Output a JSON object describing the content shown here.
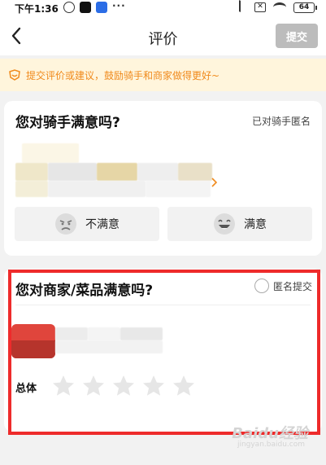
{
  "status_bar": {
    "time": "下午1:36",
    "left_icons": [
      "alarm-icon",
      "tiktok-icon",
      "baidu-icon",
      "more-dots-icon"
    ],
    "more_dots": "···",
    "right_icons": [
      "bluetooth-icon",
      "no-sim-icon",
      "wifi-icon",
      "battery-icon"
    ],
    "sim_mark": "✕",
    "battery": "64"
  },
  "nav": {
    "back_icon": "chevron-left-icon",
    "title": "评价",
    "submit_label": "提交"
  },
  "tip": {
    "icon": "reward-icon",
    "text": "提交评价或建议，鼓励骑手和商家做得更好~",
    "color": "#f08a1c"
  },
  "rider_card": {
    "title": "您对骑手满意吗?",
    "anonymous_label": "已对骑手匿名",
    "unsatisfied_label": "不满意",
    "satisfied_label": "满意",
    "unsatisfied_icon": "angry-face-icon",
    "satisfied_icon": "laughing-face-icon"
  },
  "merchant_card": {
    "title": "您对商家/菜品满意吗?",
    "anonymous_label": "匿名提交",
    "anonymous_checked": false,
    "overall_label": "总体",
    "stars_total": 5,
    "stars_selected": 0
  },
  "watermark": {
    "text": "Baidu经验",
    "sub": "jingyan.baidu.com"
  },
  "colors": {
    "accent_orange": "#f08a1c",
    "tip_background": "#fff5dc",
    "submit_disabled": "#bcbcbc",
    "highlight_red": "#ee2b2b"
  }
}
